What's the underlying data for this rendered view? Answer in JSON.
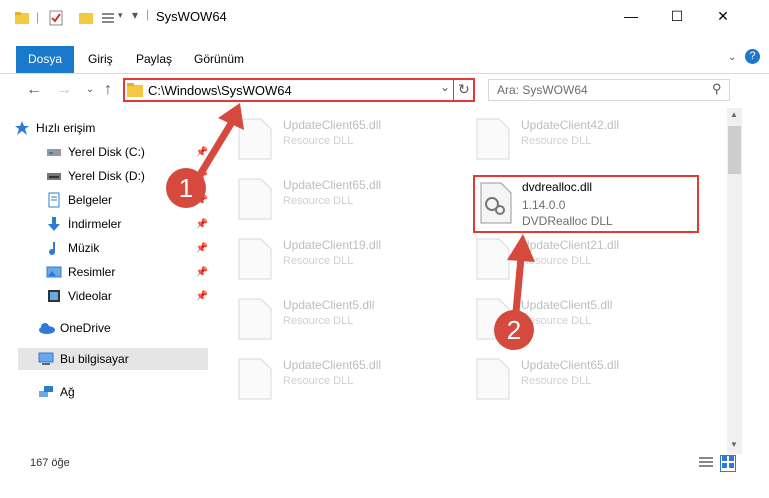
{
  "window": {
    "title": "SysWOW64"
  },
  "ribbon": {
    "tabs": [
      "Dosya",
      "Giriş",
      "Paylaş",
      "Görünüm"
    ]
  },
  "address": {
    "path": "C:\\Windows\\SysWOW64"
  },
  "search": {
    "placeholder": "Ara: SysWOW64"
  },
  "sidebar": {
    "items": [
      {
        "label": "Hızlı erişim"
      },
      {
        "label": "Yerel Disk (C:)"
      },
      {
        "label": "Yerel Disk (D:)"
      },
      {
        "label": "Belgeler"
      },
      {
        "label": "İndirmeler"
      },
      {
        "label": "Müzik"
      },
      {
        "label": "Resimler"
      },
      {
        "label": "Videolar"
      },
      {
        "label": "OneDrive"
      },
      {
        "label": "Bu bilgisayar"
      },
      {
        "label": "Ağ"
      }
    ]
  },
  "files": [
    {
      "name": "UpdateClient65.dll",
      "desc": "Resource DLL"
    },
    {
      "name": "UpdateClient42.dll",
      "desc": "Resource DLL"
    },
    {
      "name": "UpdateClient65.dll",
      "desc": "Resource DLL"
    },
    {
      "name": "dvdrealloc.dll",
      "version": "1.14.0.0",
      "desc": "DVDRealloc DLL"
    },
    {
      "name": "UpdateClient19.dll",
      "desc": "Resource DLL"
    },
    {
      "name": "UpdateClient21.dll",
      "desc": "Resource DLL"
    },
    {
      "name": "UpdateClient5.dll",
      "desc": "Resource DLL"
    },
    {
      "name": "UpdateClient5.dll",
      "desc": "Resource DLL"
    },
    {
      "name": "UpdateClient65.dll",
      "desc": "Resource DLL"
    },
    {
      "name": "UpdateClient65.dll",
      "desc": "Resource DLL"
    }
  ],
  "status": {
    "count": "167 öğe"
  },
  "annotations": {
    "badge1": "1",
    "badge2": "2"
  },
  "colors": {
    "accent": "#1979ca",
    "highlight": "#e53935",
    "badge": "#d64a3e"
  }
}
